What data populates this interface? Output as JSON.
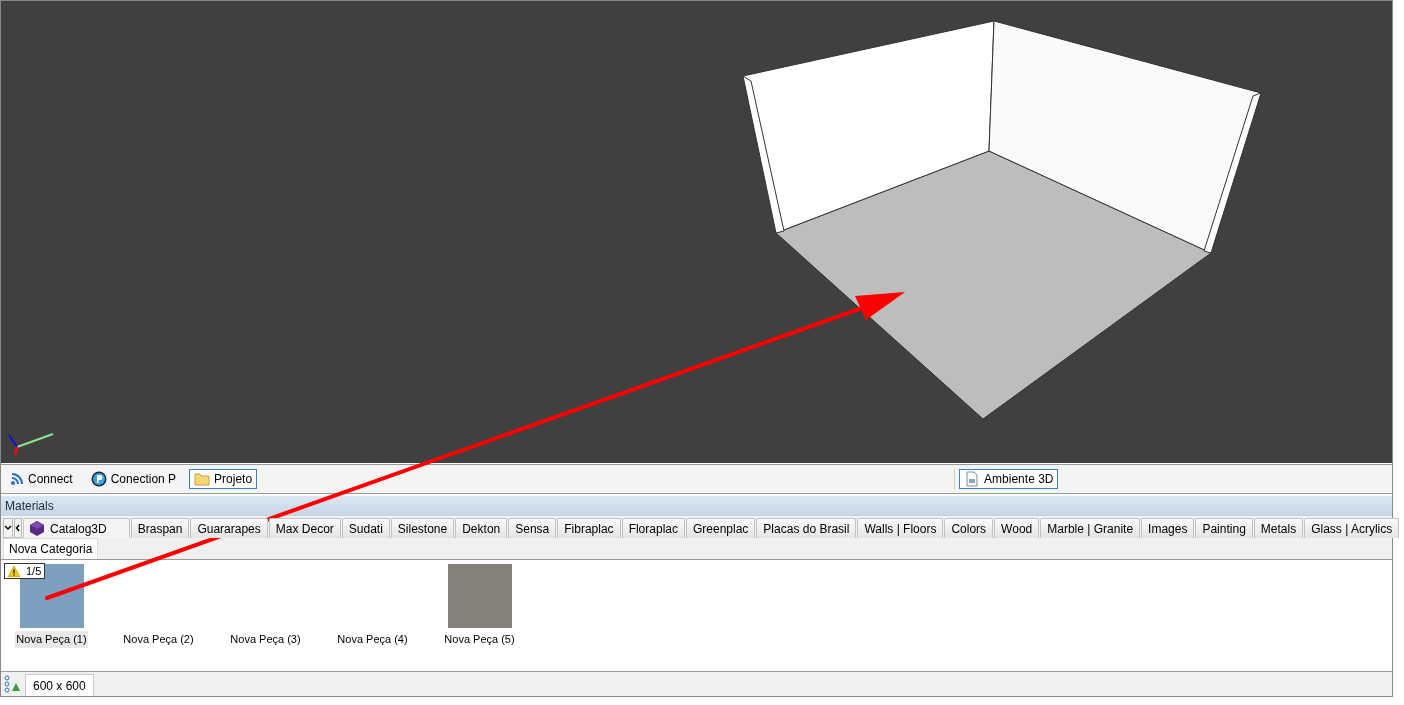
{
  "toolbar": {
    "left_items": [
      {
        "label": "Connect",
        "kind": "feed",
        "selected": false
      },
      {
        "label": "Conection P",
        "kind": "p",
        "selected": false
      },
      {
        "label": "Projeto",
        "kind": "folder",
        "selected": true
      }
    ],
    "right_items": [
      {
        "label": "Ambiente 3D",
        "kind": "doc",
        "selected": true
      }
    ]
  },
  "materials": {
    "title": "Materials",
    "tabs": [
      {
        "label": "Catalog3D",
        "selected": true
      },
      {
        "label": "Braspan",
        "selected": false
      },
      {
        "label": "Guararapes",
        "selected": false
      },
      {
        "label": "Max Decor",
        "selected": false
      },
      {
        "label": "Sudati",
        "selected": false
      },
      {
        "label": "Silestone",
        "selected": false
      },
      {
        "label": "Dekton",
        "selected": false
      },
      {
        "label": "Sensa",
        "selected": false
      },
      {
        "label": "Fibraplac",
        "selected": false
      },
      {
        "label": "Floraplac",
        "selected": false
      },
      {
        "label": "Greenplac",
        "selected": false
      },
      {
        "label": "Placas do Brasil",
        "selected": false
      },
      {
        "label": "Walls | Floors",
        "selected": false
      },
      {
        "label": "Colors",
        "selected": false
      },
      {
        "label": "Wood",
        "selected": false
      },
      {
        "label": "Marble | Granite",
        "selected": false
      },
      {
        "label": "Images",
        "selected": false
      },
      {
        "label": "Painting",
        "selected": false
      },
      {
        "label": "Metals",
        "selected": false
      },
      {
        "label": "Glass | Acrylics",
        "selected": false
      }
    ],
    "category_tabs": [
      {
        "label": "Nova Categoria",
        "selected": true
      }
    ],
    "badge": "1/5",
    "items": [
      {
        "label": "Nova Peça (1)",
        "color": "#7f9fbf",
        "selected": true
      },
      {
        "label": "Nova Peça (2)",
        "selected": false
      },
      {
        "label": "Nova Peça (3)",
        "selected": false
      },
      {
        "label": "Nova Peça (4)",
        "selected": false
      },
      {
        "label": "Nova Peça (5)",
        "color": "#85827c",
        "selected": false
      }
    ]
  },
  "status_bar": {
    "size": "600 x 600"
  }
}
